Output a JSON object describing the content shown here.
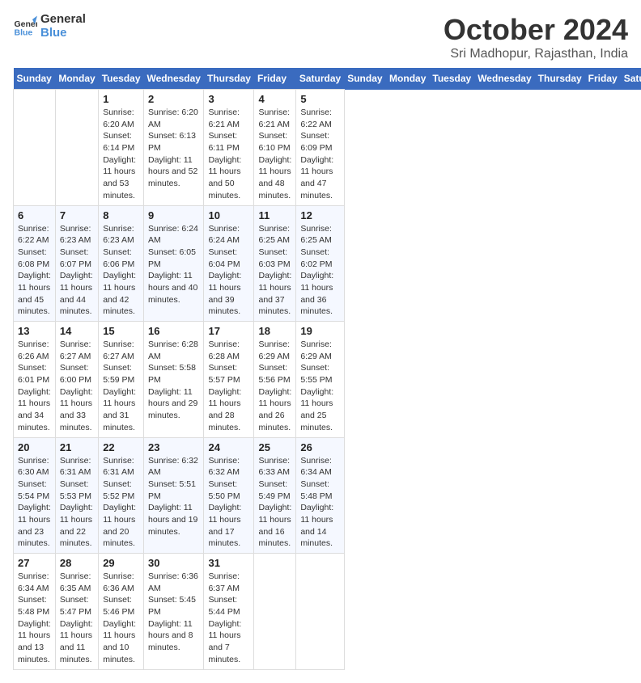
{
  "logo": {
    "line1": "General",
    "line2": "Blue"
  },
  "title": "October 2024",
  "subtitle": "Sri Madhopur, Rajasthan, India",
  "days_of_week": [
    "Sunday",
    "Monday",
    "Tuesday",
    "Wednesday",
    "Thursday",
    "Friday",
    "Saturday"
  ],
  "weeks": [
    [
      {
        "day": "",
        "info": ""
      },
      {
        "day": "",
        "info": ""
      },
      {
        "day": "1",
        "info": "Sunrise: 6:20 AM\nSunset: 6:14 PM\nDaylight: 11 hours and 53 minutes."
      },
      {
        "day": "2",
        "info": "Sunrise: 6:20 AM\nSunset: 6:13 PM\nDaylight: 11 hours and 52 minutes."
      },
      {
        "day": "3",
        "info": "Sunrise: 6:21 AM\nSunset: 6:11 PM\nDaylight: 11 hours and 50 minutes."
      },
      {
        "day": "4",
        "info": "Sunrise: 6:21 AM\nSunset: 6:10 PM\nDaylight: 11 hours and 48 minutes."
      },
      {
        "day": "5",
        "info": "Sunrise: 6:22 AM\nSunset: 6:09 PM\nDaylight: 11 hours and 47 minutes."
      }
    ],
    [
      {
        "day": "6",
        "info": "Sunrise: 6:22 AM\nSunset: 6:08 PM\nDaylight: 11 hours and 45 minutes."
      },
      {
        "day": "7",
        "info": "Sunrise: 6:23 AM\nSunset: 6:07 PM\nDaylight: 11 hours and 44 minutes."
      },
      {
        "day": "8",
        "info": "Sunrise: 6:23 AM\nSunset: 6:06 PM\nDaylight: 11 hours and 42 minutes."
      },
      {
        "day": "9",
        "info": "Sunrise: 6:24 AM\nSunset: 6:05 PM\nDaylight: 11 hours and 40 minutes."
      },
      {
        "day": "10",
        "info": "Sunrise: 6:24 AM\nSunset: 6:04 PM\nDaylight: 11 hours and 39 minutes."
      },
      {
        "day": "11",
        "info": "Sunrise: 6:25 AM\nSunset: 6:03 PM\nDaylight: 11 hours and 37 minutes."
      },
      {
        "day": "12",
        "info": "Sunrise: 6:25 AM\nSunset: 6:02 PM\nDaylight: 11 hours and 36 minutes."
      }
    ],
    [
      {
        "day": "13",
        "info": "Sunrise: 6:26 AM\nSunset: 6:01 PM\nDaylight: 11 hours and 34 minutes."
      },
      {
        "day": "14",
        "info": "Sunrise: 6:27 AM\nSunset: 6:00 PM\nDaylight: 11 hours and 33 minutes."
      },
      {
        "day": "15",
        "info": "Sunrise: 6:27 AM\nSunset: 5:59 PM\nDaylight: 11 hours and 31 minutes."
      },
      {
        "day": "16",
        "info": "Sunrise: 6:28 AM\nSunset: 5:58 PM\nDaylight: 11 hours and 29 minutes."
      },
      {
        "day": "17",
        "info": "Sunrise: 6:28 AM\nSunset: 5:57 PM\nDaylight: 11 hours and 28 minutes."
      },
      {
        "day": "18",
        "info": "Sunrise: 6:29 AM\nSunset: 5:56 PM\nDaylight: 11 hours and 26 minutes."
      },
      {
        "day": "19",
        "info": "Sunrise: 6:29 AM\nSunset: 5:55 PM\nDaylight: 11 hours and 25 minutes."
      }
    ],
    [
      {
        "day": "20",
        "info": "Sunrise: 6:30 AM\nSunset: 5:54 PM\nDaylight: 11 hours and 23 minutes."
      },
      {
        "day": "21",
        "info": "Sunrise: 6:31 AM\nSunset: 5:53 PM\nDaylight: 11 hours and 22 minutes."
      },
      {
        "day": "22",
        "info": "Sunrise: 6:31 AM\nSunset: 5:52 PM\nDaylight: 11 hours and 20 minutes."
      },
      {
        "day": "23",
        "info": "Sunrise: 6:32 AM\nSunset: 5:51 PM\nDaylight: 11 hours and 19 minutes."
      },
      {
        "day": "24",
        "info": "Sunrise: 6:32 AM\nSunset: 5:50 PM\nDaylight: 11 hours and 17 minutes."
      },
      {
        "day": "25",
        "info": "Sunrise: 6:33 AM\nSunset: 5:49 PM\nDaylight: 11 hours and 16 minutes."
      },
      {
        "day": "26",
        "info": "Sunrise: 6:34 AM\nSunset: 5:48 PM\nDaylight: 11 hours and 14 minutes."
      }
    ],
    [
      {
        "day": "27",
        "info": "Sunrise: 6:34 AM\nSunset: 5:48 PM\nDaylight: 11 hours and 13 minutes."
      },
      {
        "day": "28",
        "info": "Sunrise: 6:35 AM\nSunset: 5:47 PM\nDaylight: 11 hours and 11 minutes."
      },
      {
        "day": "29",
        "info": "Sunrise: 6:36 AM\nSunset: 5:46 PM\nDaylight: 11 hours and 10 minutes."
      },
      {
        "day": "30",
        "info": "Sunrise: 6:36 AM\nSunset: 5:45 PM\nDaylight: 11 hours and 8 minutes."
      },
      {
        "day": "31",
        "info": "Sunrise: 6:37 AM\nSunset: 5:44 PM\nDaylight: 11 hours and 7 minutes."
      },
      {
        "day": "",
        "info": ""
      },
      {
        "day": "",
        "info": ""
      }
    ]
  ]
}
